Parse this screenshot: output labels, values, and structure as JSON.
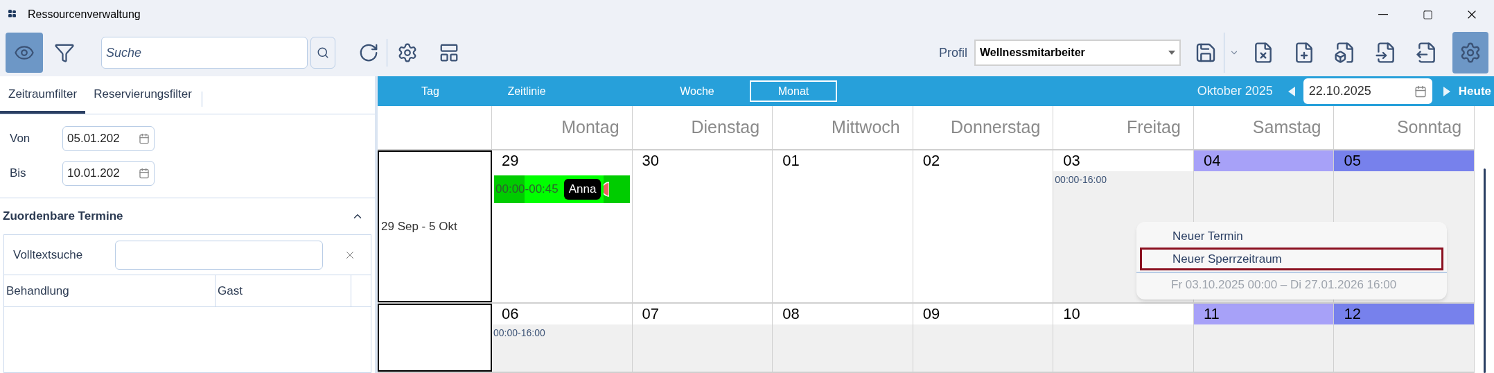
{
  "window": {
    "title": "Ressourcenverwaltung"
  },
  "toolbar": {
    "left_buttons": [
      {
        "kind": "view",
        "selected": true
      },
      {
        "kind": "filter",
        "selected": false
      }
    ],
    "search": {
      "placeholder": "Suche"
    },
    "profile": {
      "label": "Profil",
      "value": "Wellnessmitarbeiter"
    },
    "file_buttons": [
      {
        "kind": "close"
      },
      {
        "kind": "new"
      },
      {
        "kind": "package"
      },
      {
        "kind": "import"
      },
      {
        "kind": "export"
      }
    ],
    "settings_selected": true
  },
  "left_panel": {
    "tabs": [
      {
        "label": "Zeitraumfilter",
        "selected": true
      },
      {
        "label": "Reservierungsfilter",
        "selected": false
      }
    ],
    "dates": [
      {
        "label": "Von",
        "value": "05.01.202"
      },
      {
        "label": "Bis",
        "value": "10.01.202"
      }
    ],
    "section": {
      "title": "Zuordenbare Termine",
      "expanded": true,
      "search_label": "Volltextsuche",
      "columns": [
        "Behandlung",
        "Gast"
      ]
    }
  },
  "calendar": {
    "views": [
      {
        "label": "Tag",
        "selected": false
      },
      {
        "label": "Zeitlinie",
        "selected": false
      },
      {
        "label": "Woche",
        "selected": false
      },
      {
        "label": "Monat",
        "selected": true
      }
    ],
    "month": "Oktober 2025",
    "date": "22.10.2025",
    "today": "Heute",
    "weekdays": [
      "Montag",
      "Dienstag",
      "Mittwoch",
      "Donnerstag",
      "Freitag",
      "Samstag",
      "Sonntag"
    ],
    "weeks": [
      {
        "label": "29 Sep - 5 Okt",
        "days": [
          {
            "day": "29",
            "kind": "weekday",
            "blocked": false,
            "events": [
              {
                "time": "00:00-00:45",
                "guest": "Anna"
              }
            ]
          },
          {
            "day": "30",
            "kind": "weekday",
            "blocked": false
          },
          {
            "day": "01",
            "kind": "weekday",
            "blocked": false
          },
          {
            "day": "02",
            "kind": "weekday",
            "blocked": false
          },
          {
            "day": "03",
            "kind": "weekday",
            "blocked": true,
            "time": "00:00-16:00"
          },
          {
            "day": "04",
            "kind": "saturday",
            "blocked": true
          },
          {
            "day": "05",
            "kind": "sunday",
            "blocked": true
          }
        ]
      },
      {
        "days": [
          {
            "day": "06",
            "kind": "weekday",
            "blocked": true,
            "time": "00:00-16:00"
          },
          {
            "day": "07",
            "kind": "weekday",
            "blocked": true
          },
          {
            "day": "08",
            "kind": "weekday",
            "blocked": true
          },
          {
            "day": "09",
            "kind": "weekday",
            "blocked": true
          },
          {
            "day": "10",
            "kind": "weekday",
            "blocked": true
          },
          {
            "day": "11",
            "kind": "saturday",
            "blocked": true
          },
          {
            "day": "12",
            "kind": "sunday",
            "blocked": true
          }
        ]
      }
    ]
  },
  "context_menu": {
    "items": [
      {
        "label": "Neuer Termin",
        "kind": "action",
        "selected": false
      },
      {
        "label": "Neuer Sperrzeitraum",
        "kind": "action",
        "selected": true
      },
      {
        "label": "Fr 03.10.2025 00:00 – Di 27.01.2026 16:00",
        "kind": "info"
      }
    ]
  }
}
